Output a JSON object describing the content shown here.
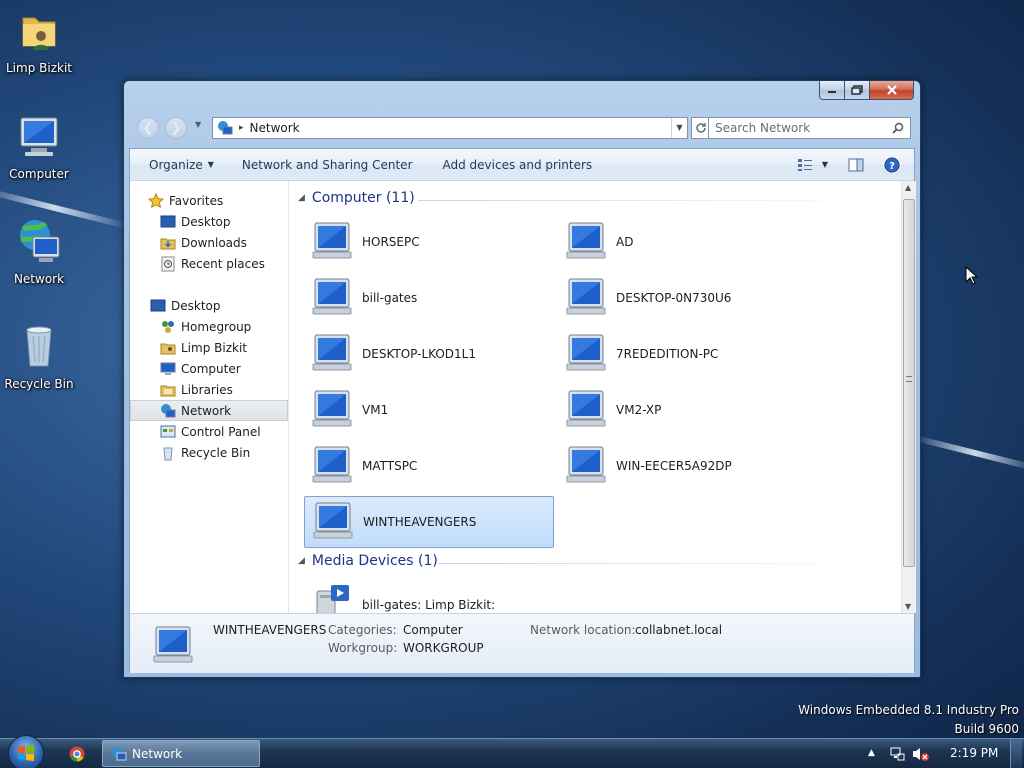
{
  "desktop": {
    "icons": [
      {
        "label": "Limp Bizkit",
        "icon": "user-folder-icon"
      },
      {
        "label": "Computer",
        "icon": "computer-icon"
      },
      {
        "label": "Network",
        "icon": "network-icon"
      },
      {
        "label": "Recycle Bin",
        "icon": "recycle-bin-icon"
      }
    ],
    "watermark": {
      "line1": "Windows Embedded 8.1 Industry Pro",
      "line2": "Build 9600"
    }
  },
  "window": {
    "address": {
      "crumb": "Network"
    },
    "search": {
      "placeholder": "Search Network"
    },
    "commands": {
      "organize": "Organize",
      "network_sharing": "Network and Sharing Center",
      "add_devices": "Add devices and printers"
    },
    "nav": {
      "favorites": {
        "header": "Favorites",
        "items": [
          "Desktop",
          "Downloads",
          "Recent places"
        ]
      },
      "desktop": {
        "header": "Desktop",
        "items": [
          "Homegroup",
          "Limp Bizkit",
          "Computer",
          "Libraries",
          "Network",
          "Control Panel",
          "Recycle Bin"
        ]
      },
      "selected": "Network"
    },
    "groups": {
      "computer": {
        "title": "Computer (11)",
        "items": [
          "HORSEPC",
          "AD",
          "bill-gates",
          "DESKTOP-0N730U6",
          "DESKTOP-LKOD1L1",
          "7REDEDITION-PC",
          "VM1",
          "VM2-XP",
          "MATTSPC",
          "WIN-EECER5A92DP",
          "WINTHEAVENGERS"
        ],
        "selected": "WINTHEAVENGERS"
      },
      "media": {
        "title": "Media Devices (1)",
        "items": [
          "bill-gates: Limp Bizkit:"
        ]
      }
    },
    "details": {
      "name": "WINTHEAVENGERS",
      "categories_label": "Categories:",
      "categories_value": "Computer",
      "workgroup_label": "Workgroup:",
      "workgroup_value": "WORKGROUP",
      "location_label": "Network location:",
      "location_value": "collabnet.local"
    }
  },
  "taskbar": {
    "task_label": "Network",
    "clock": "2:19 PM"
  },
  "colors": {
    "accent": "#1e3287",
    "selection": "#c1dcfb",
    "taskbar": "#1d3553"
  }
}
